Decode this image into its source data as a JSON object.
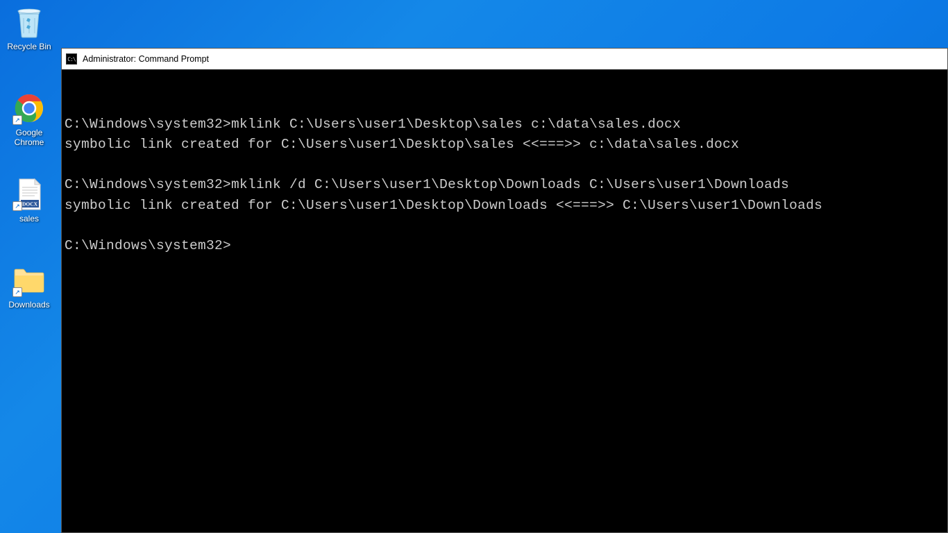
{
  "desktop": {
    "icons": [
      {
        "label": "Recycle Bin",
        "type": "recycle-bin"
      },
      {
        "label": "Google\nChrome",
        "type": "chrome",
        "shortcut": true
      },
      {
        "label": "sales",
        "type": "docx",
        "shortcut": true
      },
      {
        "label": "Downloads",
        "type": "folder",
        "shortcut": true
      }
    ]
  },
  "cmd": {
    "title": "Administrator: Command Prompt",
    "lines": [
      "",
      "C:\\Windows\\system32>mklink C:\\Users\\user1\\Desktop\\sales c:\\data\\sales.docx",
      "symbolic link created for C:\\Users\\user1\\Desktop\\sales <<===>> c:\\data\\sales.docx",
      "",
      "C:\\Windows\\system32>mklink /d C:\\Users\\user1\\Desktop\\Downloads C:\\Users\\user1\\Downloads",
      "symbolic link created for C:\\Users\\user1\\Desktop\\Downloads <<===>> C:\\Users\\user1\\Downloads",
      "",
      "C:\\Windows\\system32>"
    ]
  }
}
